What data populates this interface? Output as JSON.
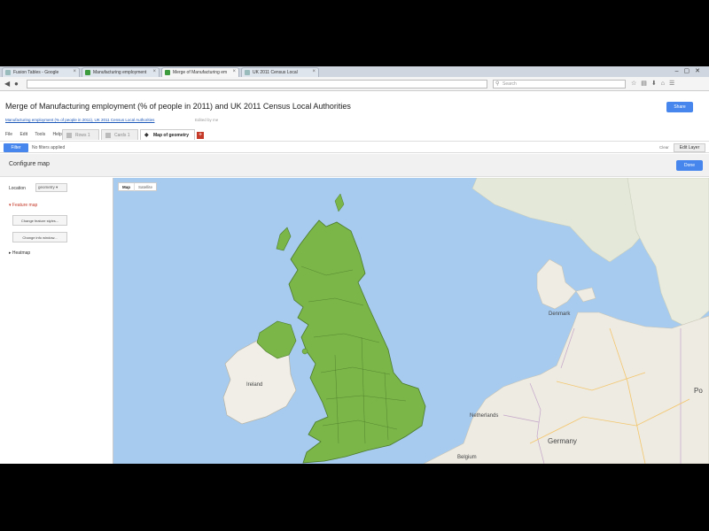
{
  "browser": {
    "tabs": [
      {
        "label": "Fusion Tables - Google",
        "favicon": "page-icon",
        "active": false
      },
      {
        "label": "Manufacturing employment",
        "favicon": "fusion-table-icon",
        "active": false
      },
      {
        "label": "Merge of Manufacturing em",
        "favicon": "fusion-table-icon",
        "active": true
      },
      {
        "label": "UK 2011 Census Local",
        "favicon": "page-icon",
        "active": false
      }
    ],
    "search_placeholder": "Search"
  },
  "document": {
    "title": "Merge of Manufacturing employment (% of people in 2011) and UK 2011 Census Local Authorities",
    "subtitle_link": "Manufacturing employment (% of people in 2011), UK 2011 Census Local Authorities",
    "saved_status": "Edited by me",
    "share_label": "Share"
  },
  "menu": [
    "File",
    "Edit",
    "Tools",
    "Help"
  ],
  "sheet_tabs": [
    {
      "label": "Rows 1",
      "active": false
    },
    {
      "label": "Cards 1",
      "active": false
    },
    {
      "label": "Map of geometry",
      "active": true
    }
  ],
  "filter": {
    "button_label": "Filter",
    "text": "No filters applied",
    "clear_label": "Clear",
    "edit_label": "Edit Layer"
  },
  "configure": {
    "title": "Configure map",
    "done_label": "Done"
  },
  "panel": {
    "location_label": "Location",
    "location_value": "geometry",
    "section_feature": "Feature map",
    "button_change_styles": "Change feature styles...",
    "button_change_info": "Change info window...",
    "section_heatmap": "Heatmap"
  },
  "map": {
    "type_map": "Map",
    "type_satellite": "Satellite",
    "labels": {
      "ireland": "Ireland",
      "denmark": "Denmark",
      "netherlands": "Netherlands",
      "germany": "Germany",
      "belgium": "Belgium",
      "poland": "Po"
    },
    "colors": {
      "water": "#a6cbef",
      "land": "#eceae3",
      "highlight": "#7ab648",
      "border": "#4c7a2a"
    }
  }
}
